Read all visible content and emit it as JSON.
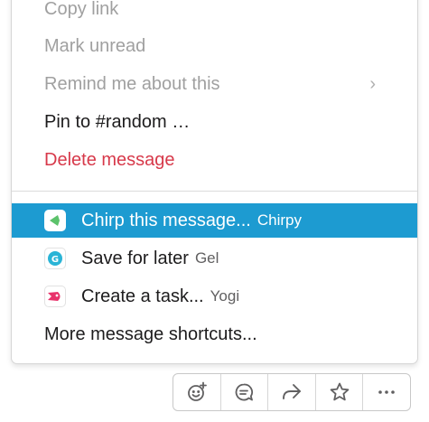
{
  "menu": {
    "items": [
      {
        "label": "Copy link",
        "state": "disabled"
      },
      {
        "label": "Mark unread",
        "state": "disabled"
      },
      {
        "label": "Remind me about this",
        "state": "disabled",
        "chevron": "›"
      },
      {
        "label": "Pin to #random …",
        "state": "normal"
      },
      {
        "label": "Delete message",
        "state": "danger"
      }
    ],
    "apps": [
      {
        "label": "Chirp this message...",
        "app": "Chirpy",
        "icon": "chirpy-icon",
        "icon_color": "#5cc26b",
        "highlighted": true
      },
      {
        "label": "Save for later",
        "app": "Gel",
        "icon": "gel-icon",
        "icon_color": "#2ab4d6"
      },
      {
        "label": "Create a task...",
        "app": "Yogi",
        "icon": "yogi-icon",
        "icon_color": "#e8326b"
      }
    ],
    "more": "More message shortcuts..."
  },
  "colors": {
    "highlight": "#1d9bd1",
    "danger": "#d7394a"
  },
  "toolbar": {
    "buttons": [
      {
        "name": "add-reaction-button",
        "icon": "emoji-add-icon"
      },
      {
        "name": "reply-thread-button",
        "icon": "comment-icon"
      },
      {
        "name": "share-message-button",
        "icon": "share-arrow-icon"
      },
      {
        "name": "save-star-button",
        "icon": "star-icon"
      },
      {
        "name": "more-actions-button",
        "icon": "ellipsis-icon"
      }
    ]
  }
}
